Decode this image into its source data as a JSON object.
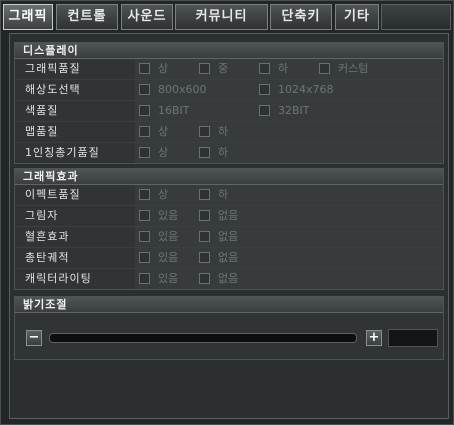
{
  "tabs": [
    {
      "label": "그래픽",
      "active": true
    },
    {
      "label": "컨트롤",
      "active": false
    },
    {
      "label": "사운드",
      "active": false
    },
    {
      "label": "커뮤니티",
      "active": false
    },
    {
      "label": "단축키",
      "active": false
    },
    {
      "label": "기타",
      "active": false
    }
  ],
  "display": {
    "header": "디스플레이",
    "rows": [
      {
        "label": "그래픽품질",
        "options": [
          "상",
          "중",
          "하",
          "커스텀"
        ]
      },
      {
        "label": "해상도선택",
        "options": [
          "800x600",
          "1024x768"
        ]
      },
      {
        "label": "색품질",
        "options": [
          "16BIT",
          "32BIT"
        ]
      },
      {
        "label": "맵품질",
        "options": [
          "상",
          "하"
        ]
      },
      {
        "label": "1인칭총기품질",
        "options": [
          "상",
          "하"
        ]
      }
    ]
  },
  "effects": {
    "header": "그래픽효과",
    "rows": [
      {
        "label": "이펙트품질",
        "options": [
          "상",
          "하"
        ]
      },
      {
        "label": "그림자",
        "options": [
          "있음",
          "없음"
        ]
      },
      {
        "label": "혈흔효과",
        "options": [
          "있음",
          "없음"
        ]
      },
      {
        "label": "총탄궤적",
        "options": [
          "있음",
          "없음"
        ]
      },
      {
        "label": "캐릭터라이팅",
        "options": [
          "있음",
          "없음"
        ]
      }
    ]
  },
  "brightness": {
    "header": "밝기조절",
    "minus": "−",
    "plus": "+",
    "value": ""
  },
  "icons": {
    "checkbox": "checkbox-icon"
  }
}
